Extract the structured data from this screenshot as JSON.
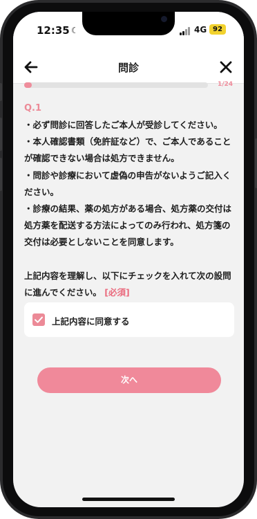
{
  "status_bar": {
    "time": "12:35",
    "moon_glyph": "☾",
    "network": "4G",
    "battery": "92"
  },
  "nav": {
    "title": "問診",
    "back_icon": "arrow-left-icon",
    "close_icon": "close-icon"
  },
  "progress": {
    "text": "1/24",
    "current": 1,
    "total": 24
  },
  "question": {
    "number": "Q.1",
    "lines": [
      "・必ず問診に回答したご本人が受診してください。",
      "・本人確認書類（免許証など）で、ご本人であること",
      "が確認できない場合は処方できません。",
      "・問診や診療において虚偽の申告がないようご記入く",
      "ださい。",
      "・診療の結果、薬の処方がある場合、処方薬の交付は",
      "処方薬を配送する方法によってのみ行われ、処方箋の",
      "交付は必要としないことを同意します。"
    ],
    "instruction_line1": "上記内容を理解し、以下にチェックを入れて次の設問",
    "instruction_line2": "に進んでください。",
    "required_label": "[必須]"
  },
  "checkbox": {
    "label": "上記内容に同意する",
    "checked": true
  },
  "next_button": {
    "label": "次へ"
  },
  "colors": {
    "accent": "#ec8a97",
    "button": "#f0899a",
    "required": "#ea6b7e",
    "background": "#f2f2f2"
  }
}
